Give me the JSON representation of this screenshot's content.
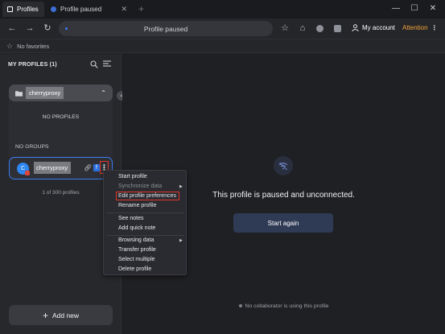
{
  "tabs": [
    {
      "label": "Profiles"
    },
    {
      "label": "Profile paused"
    }
  ],
  "window": {
    "minimize": "—",
    "maximize": "☐",
    "close": "✕"
  },
  "nav": {
    "url": "Profile paused",
    "account_label": "My account",
    "attention_label": "Attention"
  },
  "favorites": {
    "label": "No favorites"
  },
  "sidebar": {
    "title": "MY PROFILES (1)",
    "folder": {
      "name": "cherryproxy"
    },
    "no_profiles": "NO PROFILES",
    "no_groups": "NO GROUPS",
    "profile": {
      "avatar_letter": "C",
      "name": "cherryproxy"
    },
    "profile_count": "1 of 300 profiles",
    "add_new": "Add new"
  },
  "main": {
    "message": "This profile is paused and unconnected.",
    "start_again": "Start again",
    "collab_status": "No collaborator is using this profile"
  },
  "context_menu": {
    "items": [
      {
        "label": "Start profile"
      },
      {
        "label": "Synchronize data"
      },
      {
        "label": "Edit profile preferences"
      },
      {
        "label": "Rename profile"
      },
      {
        "label": "See notes"
      },
      {
        "label": "Add quick note"
      },
      {
        "label": "Browsing data"
      },
      {
        "label": "Transfer profile"
      },
      {
        "label": "Select multiple"
      },
      {
        "label": "Delete profile"
      }
    ]
  },
  "colors": {
    "accent": "#3a7cf2",
    "attention": "#f2a23a",
    "highlight_outline": "#e0362b"
  }
}
